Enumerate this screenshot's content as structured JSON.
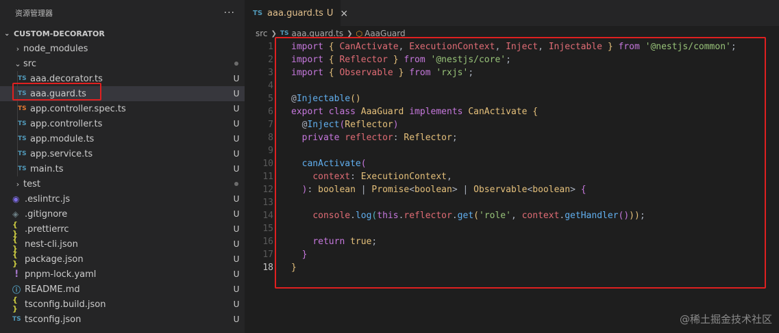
{
  "explorer": {
    "title": "资源管理器",
    "more": "···",
    "project": "CUSTOM-DECORATOR",
    "items": [
      {
        "name": "node_modules",
        "kind": "folder",
        "expanded": false,
        "depth": 0,
        "badge": ""
      },
      {
        "name": "src",
        "kind": "folder",
        "expanded": true,
        "depth": 0,
        "badge": "dot"
      },
      {
        "name": "aaa.decorator.ts",
        "kind": "ts",
        "depth": 1,
        "badge": "U"
      },
      {
        "name": "aaa.guard.ts",
        "kind": "ts",
        "depth": 1,
        "badge": "U",
        "selected": true
      },
      {
        "name": "app.controller.spec.ts",
        "kind": "ts-spec",
        "depth": 1,
        "badge": "U"
      },
      {
        "name": "app.controller.ts",
        "kind": "ts",
        "depth": 1,
        "badge": "U"
      },
      {
        "name": "app.module.ts",
        "kind": "ts",
        "depth": 1,
        "badge": "U"
      },
      {
        "name": "app.service.ts",
        "kind": "ts",
        "depth": 1,
        "badge": "U"
      },
      {
        "name": "main.ts",
        "kind": "ts",
        "depth": 1,
        "badge": "U"
      },
      {
        "name": "test",
        "kind": "folder",
        "expanded": false,
        "depth": 0,
        "badge": "dot"
      },
      {
        "name": ".eslintrc.js",
        "kind": "eslint",
        "depth": 0,
        "badge": "U"
      },
      {
        "name": ".gitignore",
        "kind": "git",
        "depth": 0,
        "badge": "U"
      },
      {
        "name": ".prettierrc",
        "kind": "json",
        "depth": 0,
        "badge": "U"
      },
      {
        "name": "nest-cli.json",
        "kind": "json",
        "depth": 0,
        "badge": "U"
      },
      {
        "name": "package.json",
        "kind": "json",
        "depth": 0,
        "badge": "U"
      },
      {
        "name": "pnpm-lock.yaml",
        "kind": "yaml",
        "depth": 0,
        "badge": "U"
      },
      {
        "name": "README.md",
        "kind": "md",
        "depth": 0,
        "badge": "U"
      },
      {
        "name": "tsconfig.build.json",
        "kind": "json",
        "depth": 0,
        "badge": "U"
      },
      {
        "name": "tsconfig.json",
        "kind": "tsconfig",
        "depth": 0,
        "badge": "U"
      }
    ]
  },
  "icons": {
    "ts": "TS",
    "json": "{ }",
    "yaml": "!",
    "chevron_right": "›",
    "chevron_down": "⌄"
  },
  "colors": {
    "ts": "#519aba",
    "ts_spec": "#e37933",
    "json": "#cbcb41",
    "yaml": "#a074c4",
    "eslint": "#7d6ce4",
    "git": "#6d8086",
    "md": "#519aba",
    "highlight": "#e02020"
  },
  "tab": {
    "icon": "TS",
    "name": "aaa.guard.ts",
    "status": "U",
    "close": "×"
  },
  "breadcrumb": {
    "folder": "src",
    "icon": "TS",
    "file": "aaa.guard.ts",
    "symbol": "AaaGuard"
  },
  "active_line": 18,
  "code": [
    [
      [
        "kw",
        "import"
      ],
      [
        "plain",
        " "
      ],
      [
        "brk",
        "{"
      ],
      [
        "plain",
        " "
      ],
      [
        "var",
        "CanActivate"
      ],
      [
        "punc",
        ", "
      ],
      [
        "var",
        "ExecutionContext"
      ],
      [
        "punc",
        ", "
      ],
      [
        "var",
        "Inject"
      ],
      [
        "punc",
        ", "
      ],
      [
        "var",
        "Injectable"
      ],
      [
        "plain",
        " "
      ],
      [
        "brk",
        "}"
      ],
      [
        "plain",
        " "
      ],
      [
        "kw",
        "from"
      ],
      [
        "plain",
        " "
      ],
      [
        "str",
        "'@nestjs/common'"
      ],
      [
        "punc",
        ";"
      ]
    ],
    [
      [
        "kw",
        "import"
      ],
      [
        "plain",
        " "
      ],
      [
        "brk",
        "{"
      ],
      [
        "plain",
        " "
      ],
      [
        "var",
        "Reflector"
      ],
      [
        "plain",
        " "
      ],
      [
        "brk",
        "}"
      ],
      [
        "plain",
        " "
      ],
      [
        "kw",
        "from"
      ],
      [
        "plain",
        " "
      ],
      [
        "str",
        "'@nestjs/core'"
      ],
      [
        "punc",
        ";"
      ]
    ],
    [
      [
        "kw",
        "import"
      ],
      [
        "plain",
        " "
      ],
      [
        "brk",
        "{"
      ],
      [
        "plain",
        " "
      ],
      [
        "var",
        "Observable"
      ],
      [
        "plain",
        " "
      ],
      [
        "brk",
        "}"
      ],
      [
        "plain",
        " "
      ],
      [
        "kw",
        "from"
      ],
      [
        "plain",
        " "
      ],
      [
        "str",
        "'rxjs'"
      ],
      [
        "punc",
        ";"
      ]
    ],
    [],
    [
      [
        "punc",
        "@"
      ],
      [
        "fn",
        "Injectable"
      ],
      [
        "brk",
        "()"
      ]
    ],
    [
      [
        "kw",
        "export"
      ],
      [
        "plain",
        " "
      ],
      [
        "kw",
        "class"
      ],
      [
        "plain",
        " "
      ],
      [
        "cls",
        "AaaGuard"
      ],
      [
        "plain",
        " "
      ],
      [
        "kw",
        "implements"
      ],
      [
        "plain",
        " "
      ],
      [
        "cls",
        "CanActivate"
      ],
      [
        "plain",
        " "
      ],
      [
        "brk",
        "{"
      ]
    ],
    [
      [
        "plain",
        "  "
      ],
      [
        "punc",
        "@"
      ],
      [
        "fn",
        "Inject"
      ],
      [
        "brk2",
        "("
      ],
      [
        "cls",
        "Reflector"
      ],
      [
        "brk2",
        ")"
      ]
    ],
    [
      [
        "plain",
        "  "
      ],
      [
        "kw",
        "private"
      ],
      [
        "plain",
        " "
      ],
      [
        "var",
        "reflector"
      ],
      [
        "punc",
        ": "
      ],
      [
        "cls",
        "Reflector"
      ],
      [
        "punc",
        ";"
      ]
    ],
    [],
    [
      [
        "plain",
        "  "
      ],
      [
        "fn",
        "canActivate"
      ],
      [
        "brk2",
        "("
      ]
    ],
    [
      [
        "plain",
        "    "
      ],
      [
        "var",
        "context"
      ],
      [
        "punc",
        ": "
      ],
      [
        "cls",
        "ExecutionContext"
      ],
      [
        "punc",
        ","
      ]
    ],
    [
      [
        "plain",
        "  "
      ],
      [
        "brk2",
        ")"
      ],
      [
        "punc",
        ": "
      ],
      [
        "cls",
        "boolean"
      ],
      [
        "punc",
        " | "
      ],
      [
        "cls",
        "Promise"
      ],
      [
        "punc",
        "<"
      ],
      [
        "cls",
        "boolean"
      ],
      [
        "punc",
        "> | "
      ],
      [
        "cls",
        "Observable"
      ],
      [
        "punc",
        "<"
      ],
      [
        "cls",
        "boolean"
      ],
      [
        "punc",
        "> "
      ],
      [
        "brk2",
        "{"
      ]
    ],
    [],
    [
      [
        "plain",
        "    "
      ],
      [
        "var",
        "console"
      ],
      [
        "punc",
        "."
      ],
      [
        "fn",
        "log"
      ],
      [
        "brk3",
        "("
      ],
      [
        "kw",
        "this"
      ],
      [
        "punc",
        "."
      ],
      [
        "var",
        "reflector"
      ],
      [
        "punc",
        "."
      ],
      [
        "fn",
        "get"
      ],
      [
        "brk",
        "("
      ],
      [
        "str",
        "'role'"
      ],
      [
        "punc",
        ", "
      ],
      [
        "var",
        "context"
      ],
      [
        "punc",
        "."
      ],
      [
        "fn",
        "getHandler"
      ],
      [
        "brk2",
        "()"
      ],
      [
        "brk",
        "))"
      ],
      [
        "punc",
        ";"
      ]
    ],
    [],
    [
      [
        "plain",
        "    "
      ],
      [
        "kw",
        "return"
      ],
      [
        "plain",
        " "
      ],
      [
        "cls",
        "true"
      ],
      [
        "punc",
        ";"
      ]
    ],
    [
      [
        "plain",
        "  "
      ],
      [
        "brk2",
        "}"
      ]
    ],
    [
      [
        "brk",
        "}"
      ]
    ]
  ],
  "watermark": "@稀土掘金技术社区"
}
